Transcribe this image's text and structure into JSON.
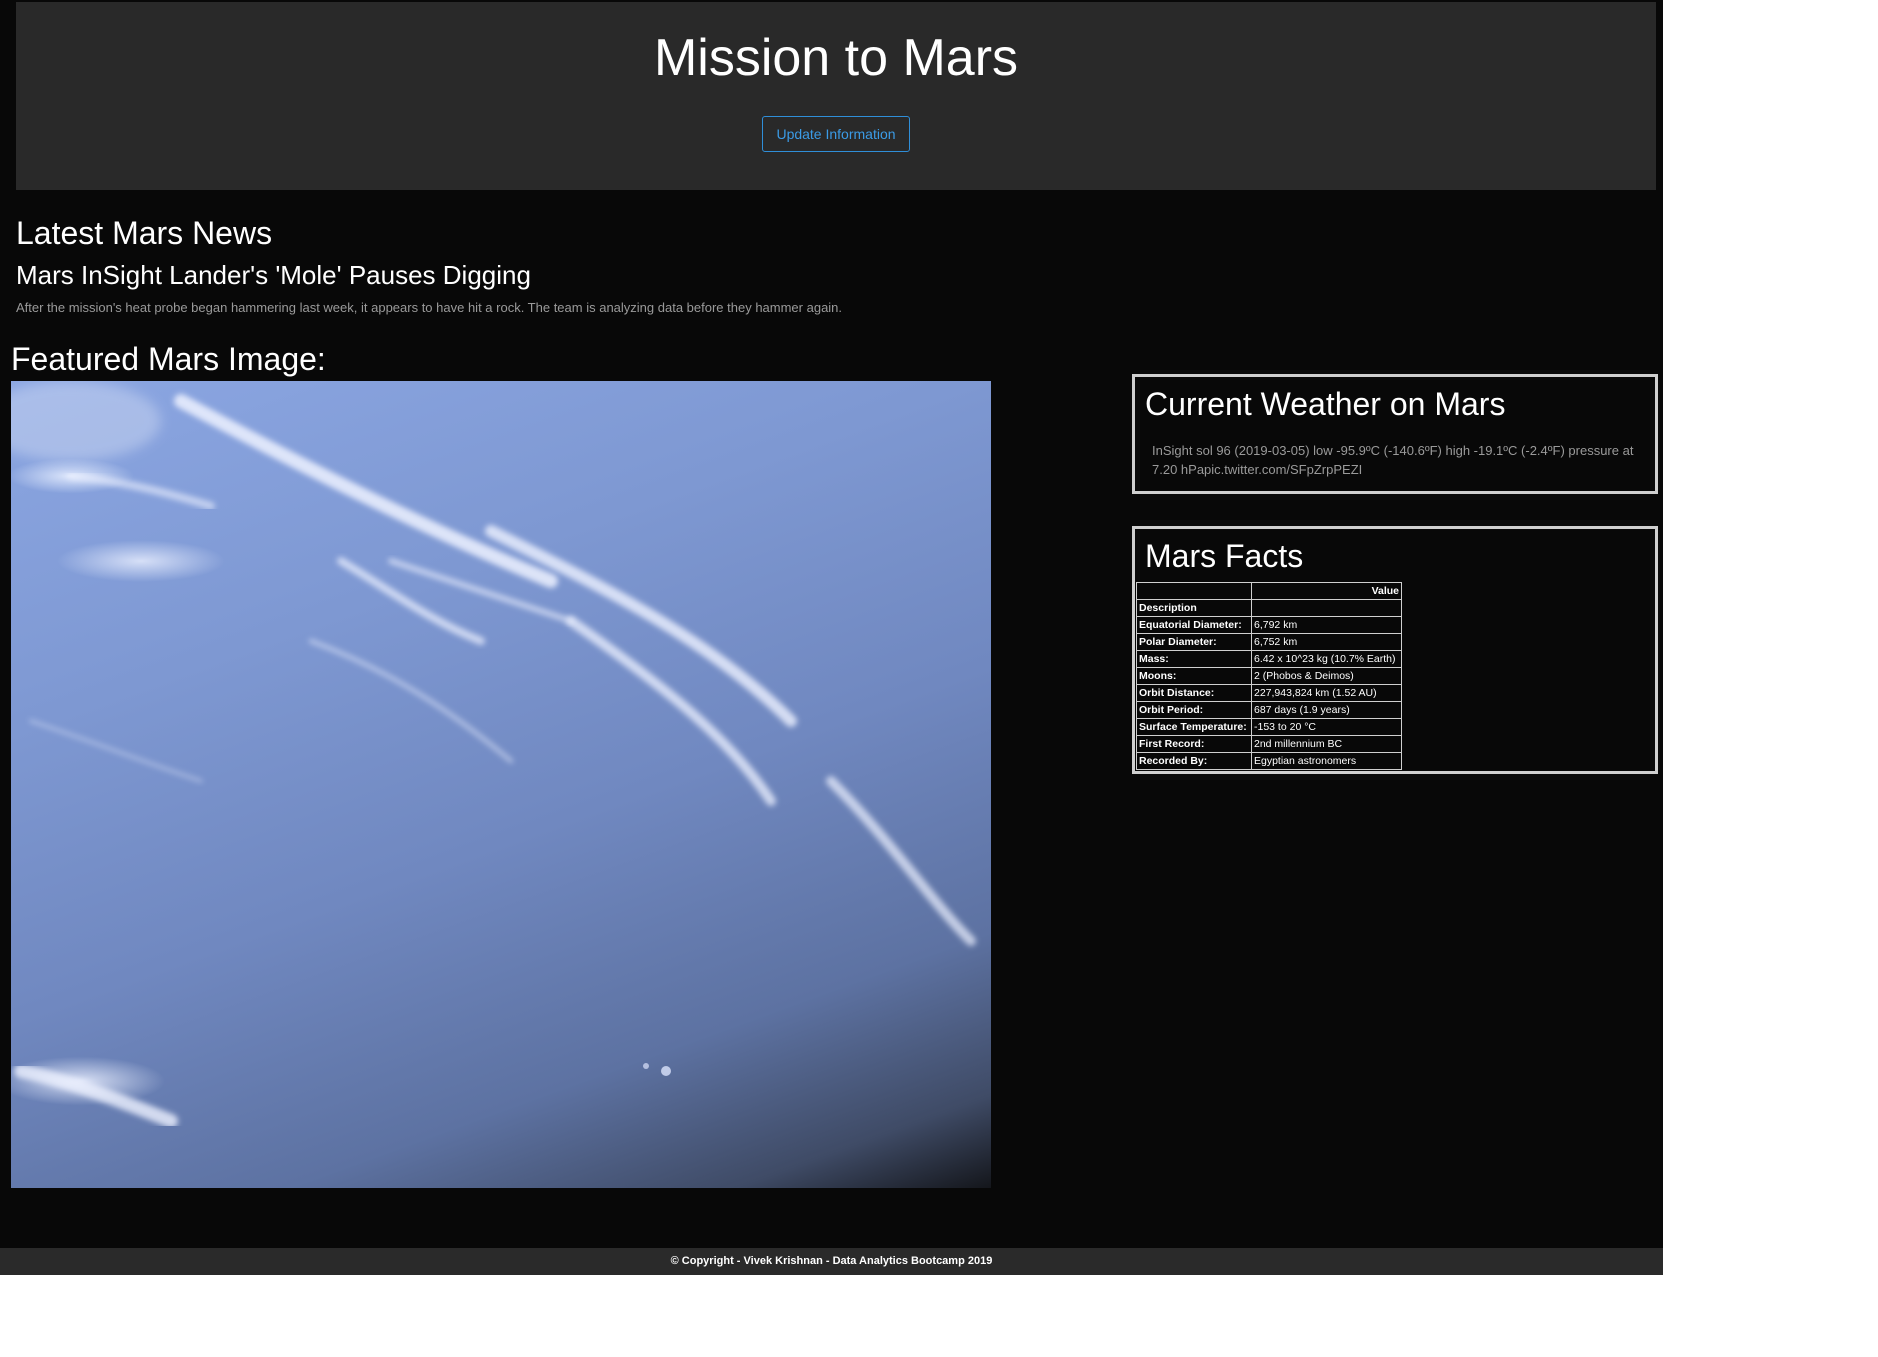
{
  "header": {
    "title": "Mission to Mars",
    "update_button": "Update Information"
  },
  "news": {
    "heading": "Latest Mars News",
    "title": "Mars InSight Lander's 'Mole' Pauses Digging",
    "teaser": "After the mission's heat probe began hammering last week, it appears to have hit a rock. The team is analyzing data before they hammer again."
  },
  "featured": {
    "heading": "Featured Mars Image:"
  },
  "weather": {
    "heading": "Current Weather on Mars",
    "text": "InSight sol 96 (2019-03-05) low -95.9ºC (-140.6ºF) high -19.1ºC (-2.4ºF) pressure at 7.20 hPapic.twitter.com/SFpZrpPEZI"
  },
  "facts": {
    "heading": "Mars Facts",
    "value_header": "Value",
    "index_header": "Description",
    "rows": [
      {
        "label": "Equatorial Diameter:",
        "value": "6,792 km"
      },
      {
        "label": "Polar Diameter:",
        "value": "6,752 km"
      },
      {
        "label": "Mass:",
        "value": "6.42 x 10^23 kg (10.7% Earth)"
      },
      {
        "label": "Moons:",
        "value": "2 (Phobos & Deimos)"
      },
      {
        "label": "Orbit Distance:",
        "value": "227,943,824 km (1.52 AU)"
      },
      {
        "label": "Orbit Period:",
        "value": "687 days (1.9 years)"
      },
      {
        "label": "Surface Temperature:",
        "value": "-153 to 20 °C"
      },
      {
        "label": "First Record:",
        "value": "2nd millennium BC"
      },
      {
        "label": "Recorded By:",
        "value": "Egyptian astronomers"
      }
    ]
  },
  "footer": {
    "text": "© Copyright - Vivek Krishnan - Data Analytics Bootcamp 2019"
  }
}
